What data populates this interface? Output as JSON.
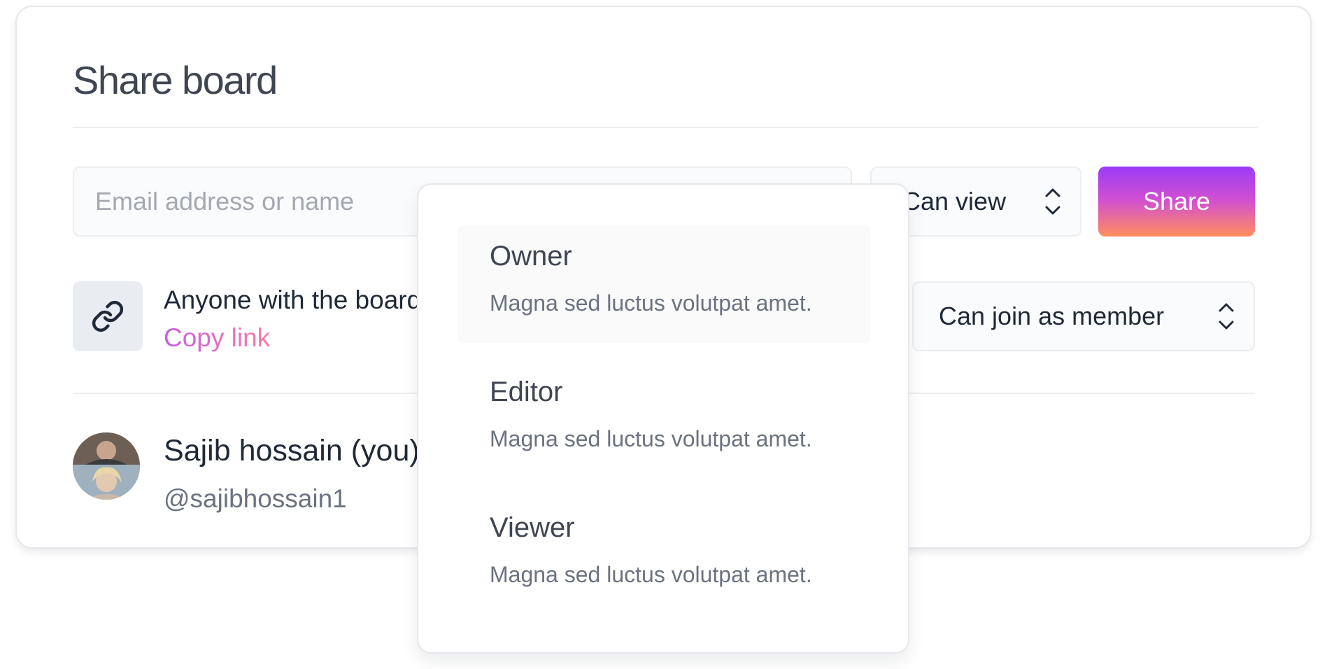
{
  "dialog": {
    "title": "Share board"
  },
  "invite": {
    "email_placeholder": "Email address or name",
    "permission_selected": "Can view",
    "share_label": "Share"
  },
  "link_section": {
    "description": "Anyone with the board link",
    "copy_label": "Copy link",
    "access_selected": "Can join as member"
  },
  "members": [
    {
      "name": "Sajib hossain (you)",
      "handle": "@sajibhossain1"
    }
  ],
  "permission_dropdown": {
    "options": [
      {
        "label": "Owner",
        "description": "Magna sed luctus volutpat amet."
      },
      {
        "label": "Editor",
        "description": "Magna sed luctus volutpat amet."
      },
      {
        "label": "Viewer",
        "description": "Magna sed luctus volutpat amet."
      }
    ]
  },
  "colors": {
    "share_gradient": [
      "#9a3cf7",
      "#d24fd1",
      "#ff8e5e"
    ],
    "copy_link_gradient": [
      "#c85ee0",
      "#f87cab"
    ],
    "title": "#3f4652",
    "muted": "#6b7280"
  },
  "icons": {
    "link": "link-icon",
    "selector": "chevron-up-down-icon"
  }
}
